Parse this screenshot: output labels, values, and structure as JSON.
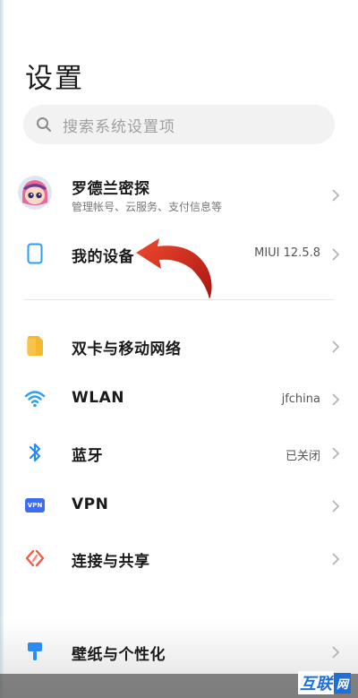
{
  "header": {
    "title": "设置"
  },
  "search": {
    "placeholder": "搜索系统设置项",
    "icon": "search-icon"
  },
  "account": {
    "name": "罗德兰密探",
    "subtitle": "管理帐号、云服务、支付信息等",
    "icon": "avatar"
  },
  "device": {
    "label": "我的设备",
    "value": "MIUI 12.5.8",
    "icon": "phone-outline-icon"
  },
  "items": [
    {
      "label": "双卡与移动网络",
      "value": "",
      "icon": "sim-card-icon",
      "color": "#f5b82e"
    },
    {
      "label": "WLAN",
      "value": "jfchina",
      "icon": "wifi-icon",
      "color": "#2a9df4"
    },
    {
      "label": "蓝牙",
      "value": "已关闭",
      "icon": "bluetooth-icon",
      "color": "#2a8cf0"
    },
    {
      "label": "VPN",
      "value": "",
      "icon": "vpn-icon",
      "color": "#3d6cf0"
    },
    {
      "label": "连接与共享",
      "value": "",
      "icon": "share-link-icon",
      "color": "#f05a4a"
    },
    {
      "label": "壁纸与个性化",
      "value": "",
      "icon": "brush-icon",
      "color": "#2a8cf0"
    }
  ],
  "vpn_badge": "VPN",
  "watermark": {
    "main": "互联",
    "box": "网"
  },
  "colors": {
    "accent": "#2a9df4",
    "arrow": "#d8281c"
  }
}
